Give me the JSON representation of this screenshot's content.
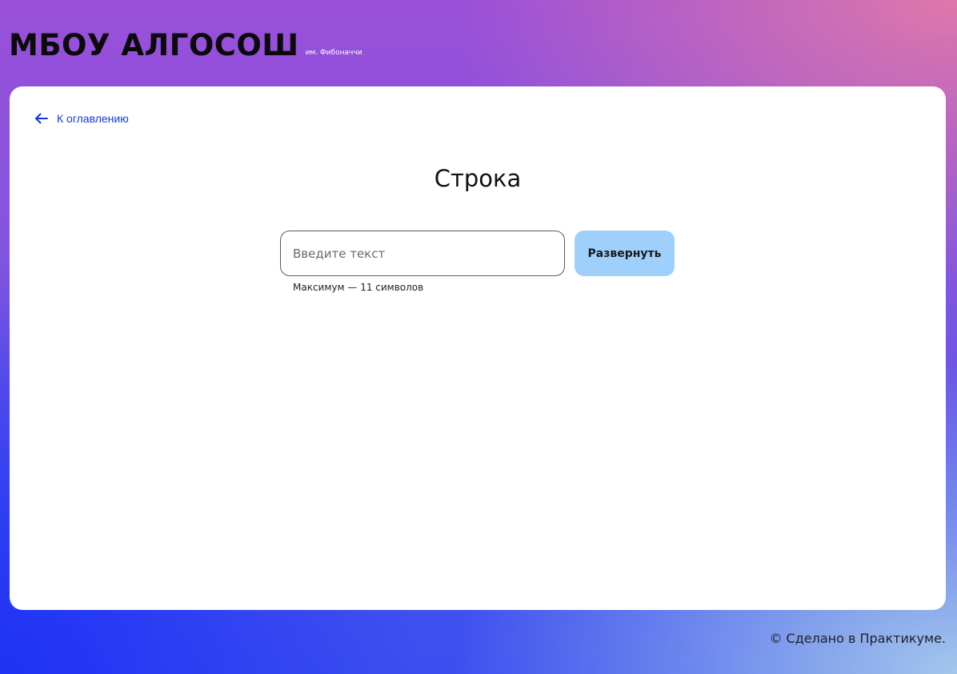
{
  "header": {
    "title": "МБОУ АЛГОСОШ",
    "subtitle": "им. Фибоначчи"
  },
  "nav": {
    "back_label": "К оглавлению"
  },
  "main": {
    "title": "Строка",
    "input": {
      "placeholder": "Введите текст",
      "value": "",
      "hint": "Максимум — 11 символов"
    },
    "submit_label": "Развернуть"
  },
  "footer": {
    "text": "© Сделано в Практикуме."
  },
  "colors": {
    "accent_link": "#1437d8",
    "button_bg": "#9ed0fb",
    "card_bg": "#ffffff"
  }
}
